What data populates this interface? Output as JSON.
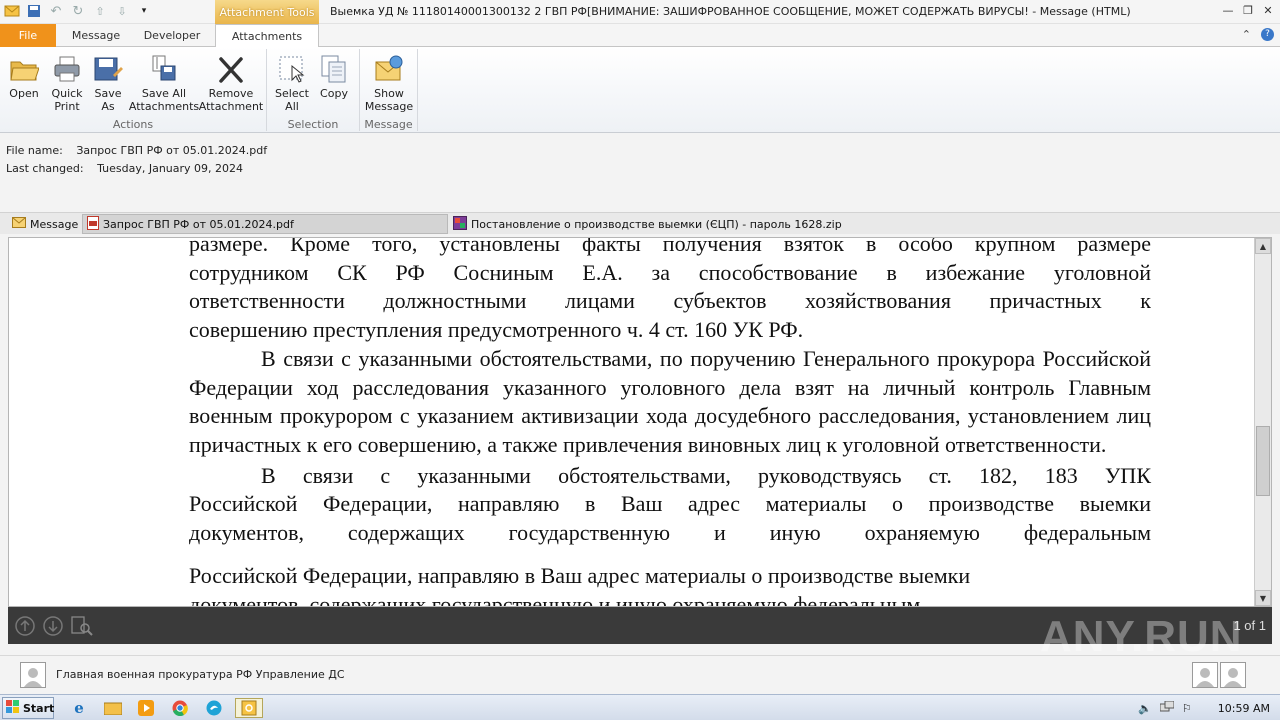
{
  "window": {
    "title": "Выемка УД № 11180140001300132 2  ГВП РФ[ВНИМАНИЕ: ЗАШИФРОВАННОЕ СООБЩЕНИЕ, МОЖЕТ СОДЕРЖАТЬ ВИРУСЫ! -  Message (HTML)",
    "tools_tab": "Attachment Tools"
  },
  "tabs": {
    "file": "File",
    "message": "Message",
    "developer": "Developer",
    "attachments": "Attachments"
  },
  "ribbon": {
    "open": "Open",
    "quick_print_1": "Quick",
    "quick_print_2": "Print",
    "save_as_1": "Save",
    "save_as_2": "As",
    "save_all_1": "Save All",
    "save_all_2": "Attachments",
    "remove_1": "Remove",
    "remove_2": "Attachment",
    "select_all_1": "Select",
    "select_all_2": "All",
    "copy": "Copy",
    "show_message_1": "Show",
    "show_message_2": "Message",
    "group_actions": "Actions",
    "group_selection": "Selection",
    "group_message": "Message"
  },
  "file_info": {
    "name_label": "File name:",
    "name_value": "Запрос ГВП РФ от 05.01.2024.pdf",
    "changed_label": "Last changed:",
    "changed_value": "Tuesday, January 09, 2024"
  },
  "attachments_bar": {
    "message": "Message",
    "pdf": "Запрос ГВП РФ от 05.01.2024.pdf",
    "zip": "Постановление о производстве выемки (ЄЦП) - пароль 1628.zip"
  },
  "document": {
    "line1": "размере. Кроме того, установлены факты получения взяток в особо крупном размере",
    "line2": "сотрудником СК РФ Сосниным Е.А. за способствование в избежание уголовной",
    "line3": "ответственности должностными лицами субъектов хозяйствования причастных к",
    "line4": "совершению преступления предусмотренного ч. 4 ст. 160 УК РФ.",
    "para2": "В связи с указанными обстоятельствами, по поручению Генерального прокурора Российской Федерации ход расследования указанного уголовного дела взят на личный контроль Главным военным прокурором с указанием активизации хода досудебного расследования, установлением лиц причастных к его совершению, а также привлечения виновных лиц к уголовной ответственности.",
    "para3_l1": "В связи с указанными обстоятельствами, руководствуясь ст. 182, 183 УПК",
    "para3_l2": "Российской Федерации, направляю в Ваш адрес материалы о производстве выемки",
    "para3_l3": "документов, содержащих государственную и иную охраняемую федеральным",
    "dup_l1": "Российской Федерации, направляю в Ваш адрес материалы о производстве выемки",
    "dup_l2": "документов, содержащих государственную и иную охраняемую федеральным"
  },
  "viewer": {
    "page_indicator": "1 of 1",
    "watermark": "ANY.RUN"
  },
  "people": {
    "sender": "Главная военная прокуратура РФ Управление ДС"
  },
  "taskbar": {
    "start": "Start",
    "clock": "10:59 AM"
  }
}
